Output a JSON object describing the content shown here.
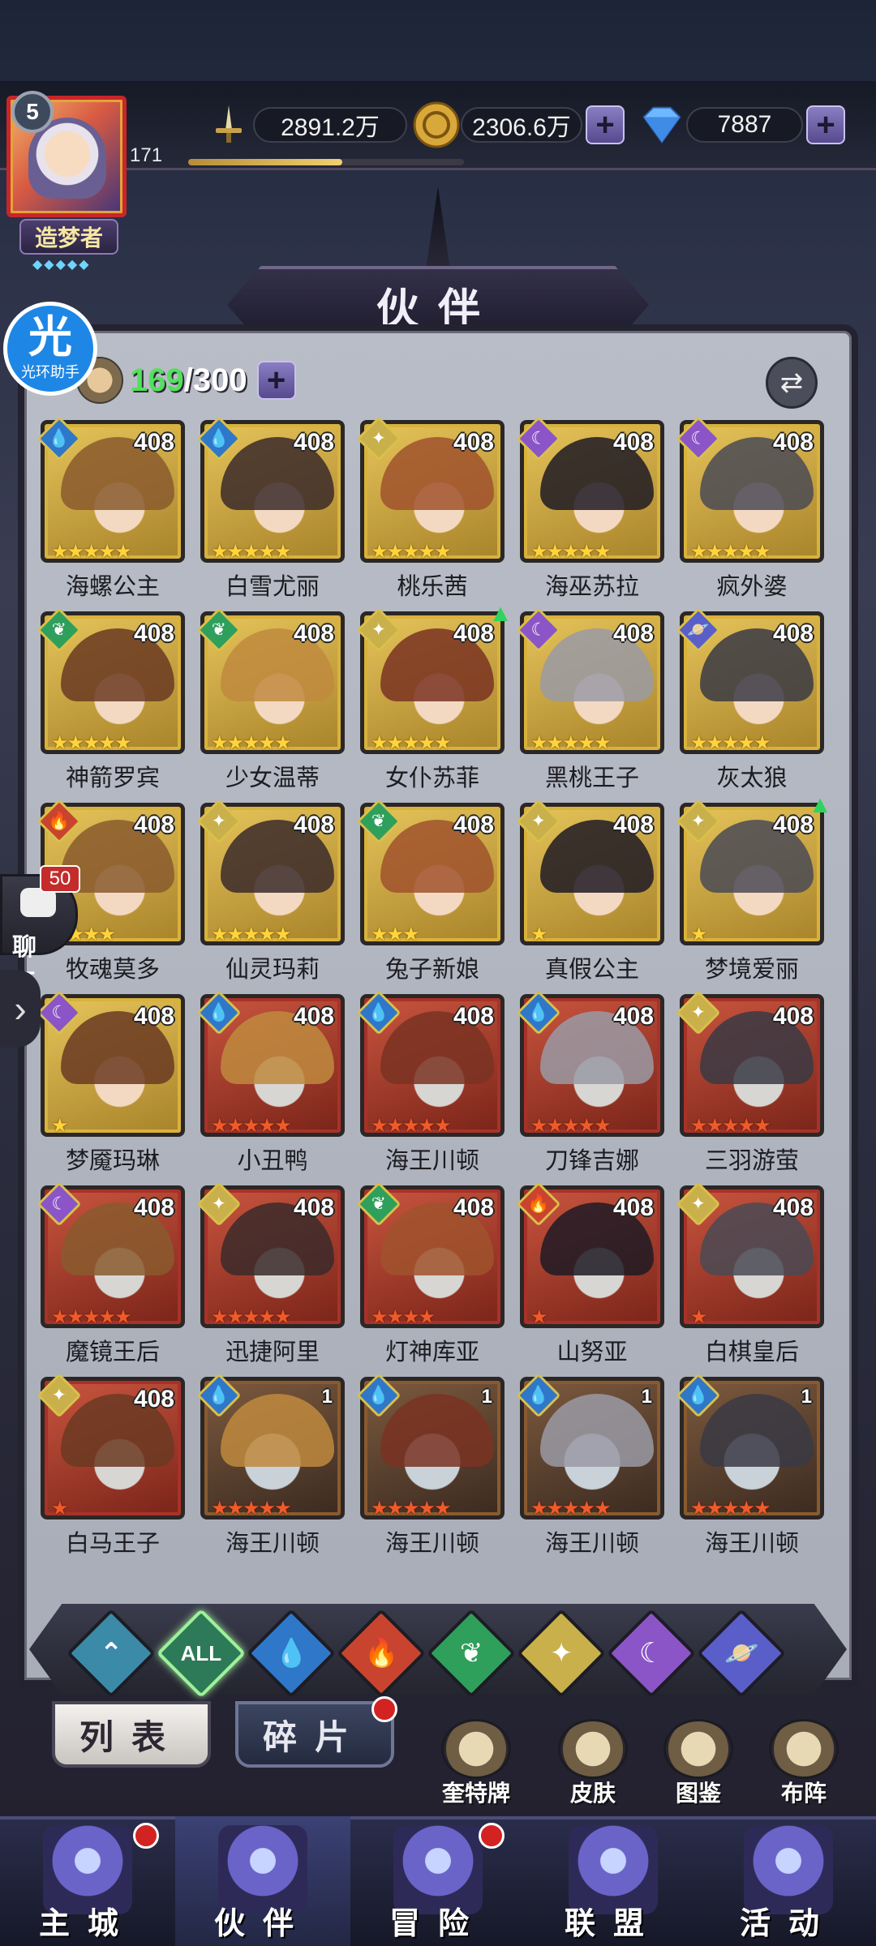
{
  "player": {
    "level": "5",
    "number": "171",
    "xp_progress": 0.56,
    "title": "造梦者",
    "title_stars": "◆◆◆◆◆"
  },
  "resources": {
    "power": "2891.2万",
    "gold": "2306.6万",
    "gems": "7887"
  },
  "page_title": "伙伴",
  "helper": {
    "glyph": "光",
    "label": "光环助手"
  },
  "capacity": {
    "current": "169",
    "max": "/300"
  },
  "heroes": [
    {
      "name": "海螺公主",
      "level": "408",
      "element": "water",
      "frame": "gold",
      "stars": "★★★★★",
      "star_color": "gold"
    },
    {
      "name": "白雪尤丽",
      "level": "408",
      "element": "water",
      "frame": "gold",
      "stars": "★★★★★",
      "star_color": "gold"
    },
    {
      "name": "桃乐茜",
      "level": "408",
      "element": "light",
      "frame": "gold",
      "stars": "★★★★★",
      "star_color": "gold"
    },
    {
      "name": "海巫苏拉",
      "level": "408",
      "element": "dark",
      "frame": "gold",
      "stars": "★★★★★",
      "star_color": "gold"
    },
    {
      "name": "疯外婆",
      "level": "408",
      "element": "dark",
      "frame": "gold",
      "stars": "★★★★★",
      "star_color": "gold"
    },
    {
      "name": "神箭罗宾",
      "level": "408",
      "element": "nature",
      "frame": "gold",
      "stars": "★★★★★",
      "star_color": "gold"
    },
    {
      "name": "少女温蒂",
      "level": "408",
      "element": "nature",
      "frame": "gold",
      "stars": "★★★★★",
      "star_color": "gold"
    },
    {
      "name": "女仆苏菲",
      "level": "408",
      "element": "light",
      "frame": "gold",
      "stars": "★★★★★",
      "star_color": "gold",
      "upgrade": true
    },
    {
      "name": "黑桃王子",
      "level": "408",
      "element": "dark",
      "frame": "gold",
      "stars": "★★★★★",
      "star_color": "gold"
    },
    {
      "name": "灰太狼",
      "level": "408",
      "element": "cosmic",
      "frame": "gold",
      "stars": "★★★★★",
      "star_color": "gold"
    },
    {
      "name": "牧魂莫多",
      "level": "408",
      "element": "fire",
      "frame": "gold",
      "stars": "★★★★",
      "star_color": "gold"
    },
    {
      "name": "仙灵玛莉",
      "level": "408",
      "element": "light",
      "frame": "gold",
      "stars": "★★★★★",
      "star_color": "gold"
    },
    {
      "name": "兔子新娘",
      "level": "408",
      "element": "nature",
      "frame": "gold",
      "stars": "★★★",
      "star_color": "gold"
    },
    {
      "name": "真假公主",
      "level": "408",
      "element": "light",
      "frame": "gold",
      "stars": "★",
      "star_color": "gold"
    },
    {
      "name": "梦境爱丽",
      "level": "408",
      "element": "light",
      "frame": "gold",
      "stars": "★",
      "star_color": "gold",
      "upgrade": true
    },
    {
      "name": "梦魇玛琳",
      "level": "408",
      "element": "dark",
      "frame": "gold",
      "stars": "★",
      "star_color": "gold"
    },
    {
      "name": "小丑鸭",
      "level": "408",
      "element": "water",
      "frame": "red",
      "stars": "★★★★★",
      "star_color": "red"
    },
    {
      "name": "海王川顿",
      "level": "408",
      "element": "water",
      "frame": "red",
      "stars": "★★★★★",
      "star_color": "red"
    },
    {
      "name": "刀锋吉娜",
      "level": "408",
      "element": "water",
      "frame": "red",
      "stars": "★★★★★",
      "star_color": "red"
    },
    {
      "name": "三羽游萤",
      "level": "408",
      "element": "light",
      "frame": "red",
      "stars": "★★★★★",
      "star_color": "red"
    },
    {
      "name": "魔镜王后",
      "level": "408",
      "element": "dark",
      "frame": "red",
      "stars": "★★★★★",
      "star_color": "red"
    },
    {
      "name": "迅捷阿里",
      "level": "408",
      "element": "light",
      "frame": "red",
      "stars": "★★★★★",
      "star_color": "red"
    },
    {
      "name": "灯神库亚",
      "level": "408",
      "element": "nature",
      "frame": "red",
      "stars": "★★★★",
      "star_color": "red"
    },
    {
      "name": "山努亚",
      "level": "408",
      "element": "fire",
      "frame": "red",
      "stars": "★",
      "star_color": "red"
    },
    {
      "name": "白棋皇后",
      "level": "408",
      "element": "light",
      "frame": "red",
      "stars": "★",
      "star_color": "red"
    },
    {
      "name": "白马王子",
      "level": "408",
      "element": "light",
      "frame": "red",
      "stars": "★",
      "star_color": "red"
    },
    {
      "name": "海王川顿",
      "level": "1",
      "element": "water",
      "frame": "dark",
      "stars": "★★★★★",
      "star_color": "red"
    },
    {
      "name": "海王川顿",
      "level": "1",
      "element": "water",
      "frame": "dark",
      "stars": "★★★★★",
      "star_color": "red"
    },
    {
      "name": "海王川顿",
      "level": "1",
      "element": "water",
      "frame": "dark",
      "stars": "★★★★★",
      "star_color": "red"
    },
    {
      "name": "海王川顿",
      "level": "1",
      "element": "water",
      "frame": "dark",
      "stars": "★★★★★",
      "star_color": "red"
    }
  ],
  "element_icons": {
    "water": "💧",
    "light": "✦",
    "dark": "☾",
    "nature": "❦",
    "fire": "🔥",
    "cosmic": "🪐"
  },
  "element_colors": {
    "water": "#2f77c9",
    "light": "#c9b04a",
    "dark": "#8b55c7",
    "nature": "#2f9f5c",
    "fire": "#c8442e",
    "cosmic": "#5a5ec8"
  },
  "chat": {
    "badge": "50",
    "label": "聊天"
  },
  "filters": [
    {
      "id": "faction",
      "label": "⌃",
      "color": "#3a8aa8"
    },
    {
      "id": "all",
      "label": "ALL",
      "color": "#2c7a58",
      "selected": true
    },
    {
      "id": "water",
      "label": "💧",
      "color": "#2f77c9"
    },
    {
      "id": "fire",
      "label": "🔥",
      "color": "#c8442e"
    },
    {
      "id": "nature",
      "label": "❦",
      "color": "#2f9f5c"
    },
    {
      "id": "light",
      "label": "✦",
      "color": "#c9b04a"
    },
    {
      "id": "dark",
      "label": "☾",
      "color": "#8b55c7"
    },
    {
      "id": "cosmic",
      "label": "🪐",
      "color": "#5a5ec8"
    }
  ],
  "subtabs": {
    "list": "列表",
    "fragments": "碎片"
  },
  "shortcuts": [
    "奎特牌",
    "皮肤",
    "图鉴",
    "布阵"
  ],
  "bottom_nav": [
    "主城",
    "伙伴",
    "冒险",
    "联盟",
    "活动"
  ]
}
